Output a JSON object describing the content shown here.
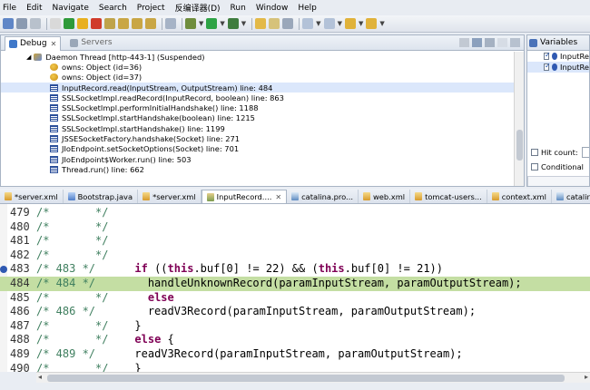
{
  "menu": [
    "File",
    "Edit",
    "Navigate",
    "Search",
    "Project",
    "反编译器(D)",
    "Run",
    "Window",
    "Help"
  ],
  "colors": {
    "highlight_line": "#c4dea3",
    "keyword": "#7f0055",
    "comment": "#3f7f5f",
    "breakpoint": "#2f59b2"
  },
  "debug_panel": {
    "tabs": [
      {
        "label": "Debug",
        "icon": "debug-icon",
        "active": true
      },
      {
        "label": "Servers",
        "icon": "servers-icon",
        "active": false
      }
    ],
    "tree": [
      {
        "label": "Daemon Thread [http-443-1] (Suspended)",
        "icon": "thread-icon",
        "indent": 1
      },
      {
        "label": "owns: Object  (id=36)",
        "icon": "monitor-icon",
        "indent": 2
      },
      {
        "label": "owns: Object  (id=37)",
        "icon": "monitor-icon",
        "indent": 2
      },
      {
        "label": "InputRecord.read(InputStream, OutputStream) line: 484",
        "icon": "stack-frame-icon",
        "indent": 2,
        "selected": true
      },
      {
        "label": "SSLSocketImpl.readRecord(InputRecord, boolean) line: 863",
        "icon": "stack-frame-icon",
        "indent": 2
      },
      {
        "label": "SSLSocketImpl.performInitialHandshake() line: 1188",
        "icon": "stack-frame-icon",
        "indent": 2
      },
      {
        "label": "SSLSocketImpl.startHandshake(boolean) line: 1215",
        "icon": "stack-frame-icon",
        "indent": 2
      },
      {
        "label": "SSLSocketImpl.startHandshake() line: 1199",
        "icon": "stack-frame-icon",
        "indent": 2
      },
      {
        "label": "JSSESocketFactory.handshake(Socket) line: 271",
        "icon": "stack-frame-icon",
        "indent": 2
      },
      {
        "label": "JIoEndpoint.setSocketOptions(Socket) line: 701",
        "icon": "stack-frame-icon",
        "indent": 2
      },
      {
        "label": "JIoEndpoint$Worker.run() line: 503",
        "icon": "stack-frame-icon",
        "indent": 2
      },
      {
        "label": "Thread.run() line: 662",
        "icon": "stack-frame-icon",
        "indent": 2
      }
    ]
  },
  "vars_panel": {
    "tab": "Variables",
    "rows": [
      "InputRe",
      "InputRe"
    ],
    "hit_count_label": "Hit count:",
    "conditional_label": "Conditional"
  },
  "editor_tabs": [
    {
      "label": "*server.xml",
      "icon": "xml-file-icon"
    },
    {
      "label": "Bootstrap.java",
      "icon": "java-file-icon"
    },
    {
      "label": "*server.xml",
      "icon": "xml-file-icon"
    },
    {
      "label": "InputRecord....",
      "icon": "class-file-icon",
      "active": true,
      "close": "✕"
    },
    {
      "label": "catalina.pro...",
      "icon": "properties-file-icon"
    },
    {
      "label": "web.xml",
      "icon": "xml-file-icon"
    },
    {
      "label": "tomcat-users...",
      "icon": "xml-file-icon"
    },
    {
      "label": "context.xml",
      "icon": "xml-file-icon"
    },
    {
      "label": "catalina",
      "icon": "properties-file-icon"
    }
  ],
  "code_lines": [
    {
      "num": "479",
      "comment": "/*       */",
      "code": ""
    },
    {
      "num": "480",
      "comment": "/*       */",
      "code": ""
    },
    {
      "num": "481",
      "comment": "/*       */",
      "code": ""
    },
    {
      "num": "482",
      "comment": "/*       */",
      "code": ""
    },
    {
      "num": "483",
      "comment": "/* 483 */",
      "pre": "      ",
      "kw": "if",
      "code": " ((this.buf[0] != 22) && (this.buf[0] != 21))",
      "breakpoint": true
    },
    {
      "num": "484",
      "comment": "/* 484 */",
      "pre": "        ",
      "code": "handleUnknownRecord(paramInputStream, paramOutputStream);",
      "highlight": true
    },
    {
      "num": "485",
      "comment": "/*       */",
      "pre": "      ",
      "kw": "else",
      "code": ""
    },
    {
      "num": "486",
      "comment": "/* 486 */",
      "pre": "        ",
      "code": "readV3Record(paramInputStream, paramOutputStream);"
    },
    {
      "num": "487",
      "comment": "/*       */",
      "pre": "    ",
      "code": "}"
    },
    {
      "num": "488",
      "comment": "/*       */",
      "pre": "    ",
      "kw": "else",
      "code": " {"
    },
    {
      "num": "489",
      "comment": "/* 489 */",
      "pre": "      ",
      "code": "readV3Record(paramInputStream, paramOutputStream);"
    },
    {
      "num": "490",
      "comment": "/*       */",
      "pre": "    ",
      "code": "}"
    }
  ]
}
